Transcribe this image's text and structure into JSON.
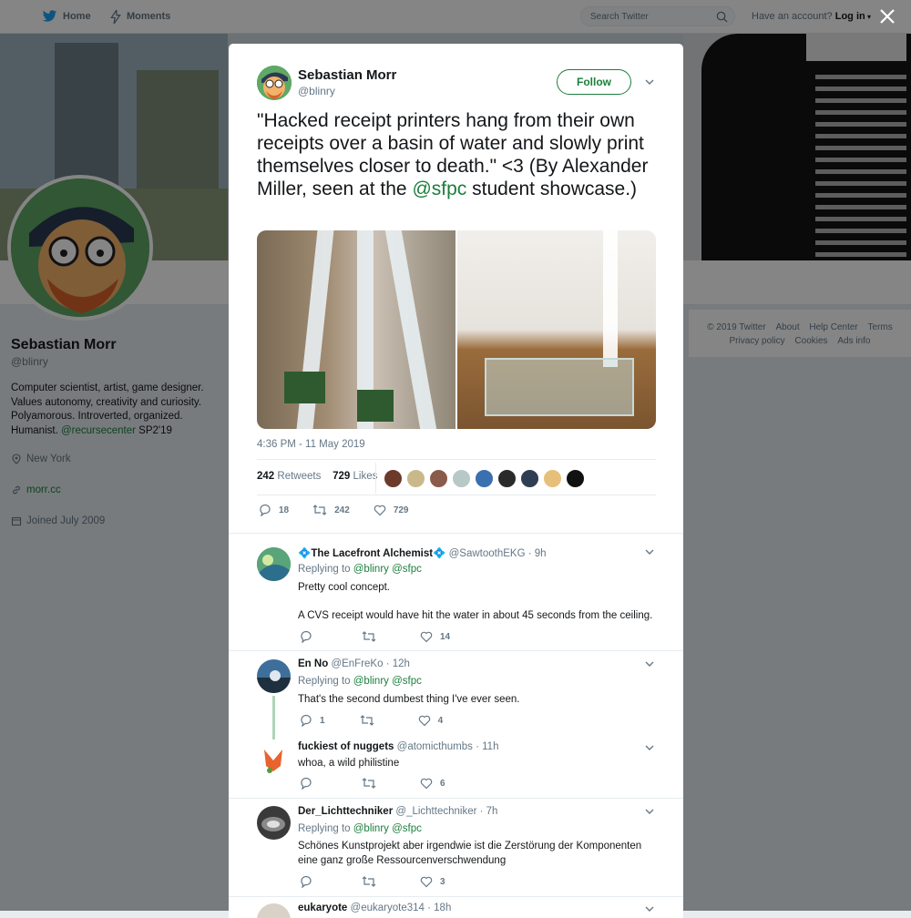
{
  "nav": {
    "home": "Home",
    "moments": "Moments",
    "search_placeholder": "Search Twitter",
    "have_account": "Have an account?",
    "login": "Log in"
  },
  "profile": {
    "name": "Sebastian Morr",
    "handle": "@blinry",
    "bio_line1": "Computer scientist, artist, game designer.",
    "bio_line2": "Values autonomy, creativity and curiosity.",
    "bio_line3": "Polyamorous. Introverted, organized.",
    "bio_line4_pre": "Humanist.",
    "bio_mention": "@recursecenter",
    "bio_line4_post": "SP2'19",
    "location": "New York",
    "website": "morr.cc",
    "joined": "Joined July 2009"
  },
  "footer": {
    "copyright": "© 2019 Twitter",
    "about": "About",
    "help": "Help Center",
    "terms": "Terms",
    "privacy": "Privacy policy",
    "cookies": "Cookies",
    "ads": "Ads info"
  },
  "tweet": {
    "author_name": "Sebastian Morr",
    "author_handle": "@blinry",
    "follow_label": "Follow",
    "text_pre": "\"Hacked receipt printers hang from their own receipts over a basin of water and slowly print themselves closer to death.\" <3 (By Alexander Miller, seen at the",
    "text_link": "@sfpc",
    "text_post": "student showcase.)",
    "timestamp": "4:36 PM - 11 May 2019",
    "retweets_count": "242",
    "retweets_label": "Retweets",
    "likes_count": "729",
    "likes_label": "Likes",
    "reply_count": "18",
    "retweet_count": "242",
    "like_count": "729"
  },
  "replies": [
    {
      "name": "💠The Lacefront Alchemist💠",
      "handle": "@SawtoothEKG",
      "time": "· 9h",
      "replying": "Replying to",
      "to1": "@blinry",
      "to2": "@sfpc",
      "text1": "Pretty cool concept.",
      "text2": "A CVS receipt would have hit the water in about 45 seconds from the ceiling.",
      "replies": "",
      "retweets": "",
      "likes": "14"
    },
    {
      "name": "En No",
      "handle": "@EnFreKo",
      "time": "· 12h",
      "replying": "Replying to",
      "to1": "@blinry",
      "to2": "@sfpc",
      "text1": "That's the second dumbest thing I've ever seen.",
      "replies": "1",
      "retweets": "",
      "likes": "4"
    },
    {
      "name": "fuckiest of nuggets",
      "handle": "@atomicthumbs",
      "time": "· 11h",
      "text1": "whoa, a wild philistine",
      "replies": "",
      "retweets": "",
      "likes": "6"
    },
    {
      "name": "Der_Lichttechniker",
      "handle": "@_Lichttechniker",
      "time": "· 7h",
      "replying": "Replying to",
      "to1": "@blinry",
      "to2": "@sfpc",
      "text1": "Schönes Kunstprojekt aber irgendwie ist die Zerstörung der Komponenten eine ganz große Ressourcenverschwendung",
      "replies": "",
      "retweets": "",
      "likes": "3"
    },
    {
      "name": "eukaryote",
      "handle": "@eukaryote314",
      "time": "· 18h"
    }
  ],
  "colors": {
    "accent": "#1b7f3c",
    "text": "#14171a",
    "muted": "#657786"
  }
}
